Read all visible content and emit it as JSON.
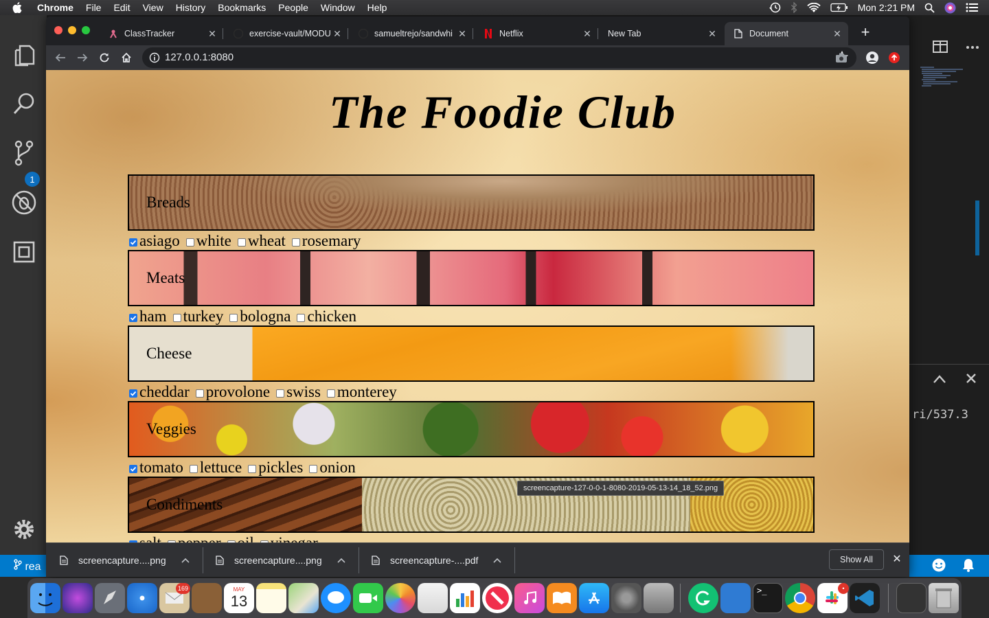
{
  "menubar": {
    "app": "Chrome",
    "items": [
      "File",
      "Edit",
      "View",
      "History",
      "Bookmarks",
      "People",
      "Window",
      "Help"
    ],
    "clock": "Mon 2:21 PM"
  },
  "vscode": {
    "scm_badge": "1",
    "status_branch": "rea",
    "terminal_text": "ri/537.3"
  },
  "browser": {
    "tabs": [
      {
        "title": "ClassTracker"
      },
      {
        "title": "exercise-vault/MODU"
      },
      {
        "title": "samueltrejo/sandwhi"
      },
      {
        "title": "Netflix"
      },
      {
        "title": "New Tab"
      },
      {
        "title": "Document"
      }
    ],
    "new_tab_label": "+",
    "url": "127.0.0.1:8080"
  },
  "page": {
    "title": "The Foodie Club",
    "sections": [
      {
        "label": "Breads",
        "options": [
          {
            "label": "asiago",
            "checked": true
          },
          {
            "label": "white",
            "checked": false
          },
          {
            "label": "wheat",
            "checked": false
          },
          {
            "label": "rosemary",
            "checked": false
          }
        ]
      },
      {
        "label": "Meats",
        "options": [
          {
            "label": "ham",
            "checked": true
          },
          {
            "label": "turkey",
            "checked": false
          },
          {
            "label": "bologna",
            "checked": false
          },
          {
            "label": "chicken",
            "checked": false
          }
        ]
      },
      {
        "label": "Cheese",
        "options": [
          {
            "label": "cheddar",
            "checked": true
          },
          {
            "label": "provolone",
            "checked": false
          },
          {
            "label": "swiss",
            "checked": false
          },
          {
            "label": "monterey",
            "checked": false
          }
        ]
      },
      {
        "label": "Veggies",
        "options": [
          {
            "label": "tomato",
            "checked": true
          },
          {
            "label": "lettuce",
            "checked": false
          },
          {
            "label": "pickles",
            "checked": false
          },
          {
            "label": "onion",
            "checked": false
          }
        ]
      },
      {
        "label": "Condiments",
        "options": [
          {
            "label": "salt",
            "checked": true
          },
          {
            "label": "pepper",
            "checked": false
          },
          {
            "label": "oil",
            "checked": false
          },
          {
            "label": "vinegar",
            "checked": false
          }
        ]
      }
    ],
    "tooltip": "screencapture-127-0-0-1-8080-2019-05-13-14_18_52.png"
  },
  "downloads": {
    "items": [
      {
        "name": "screencapture....png"
      },
      {
        "name": "screencapture....png"
      },
      {
        "name": "screencapture-....pdf"
      }
    ],
    "show_all": "Show All"
  },
  "dock": {
    "mail_badge": "169",
    "calendar_month": "MAY",
    "calendar_day": "13"
  },
  "colors": {
    "accent": "#1a73e8",
    "vscode_status": "#007acc",
    "chrome_dark": "#202124"
  }
}
